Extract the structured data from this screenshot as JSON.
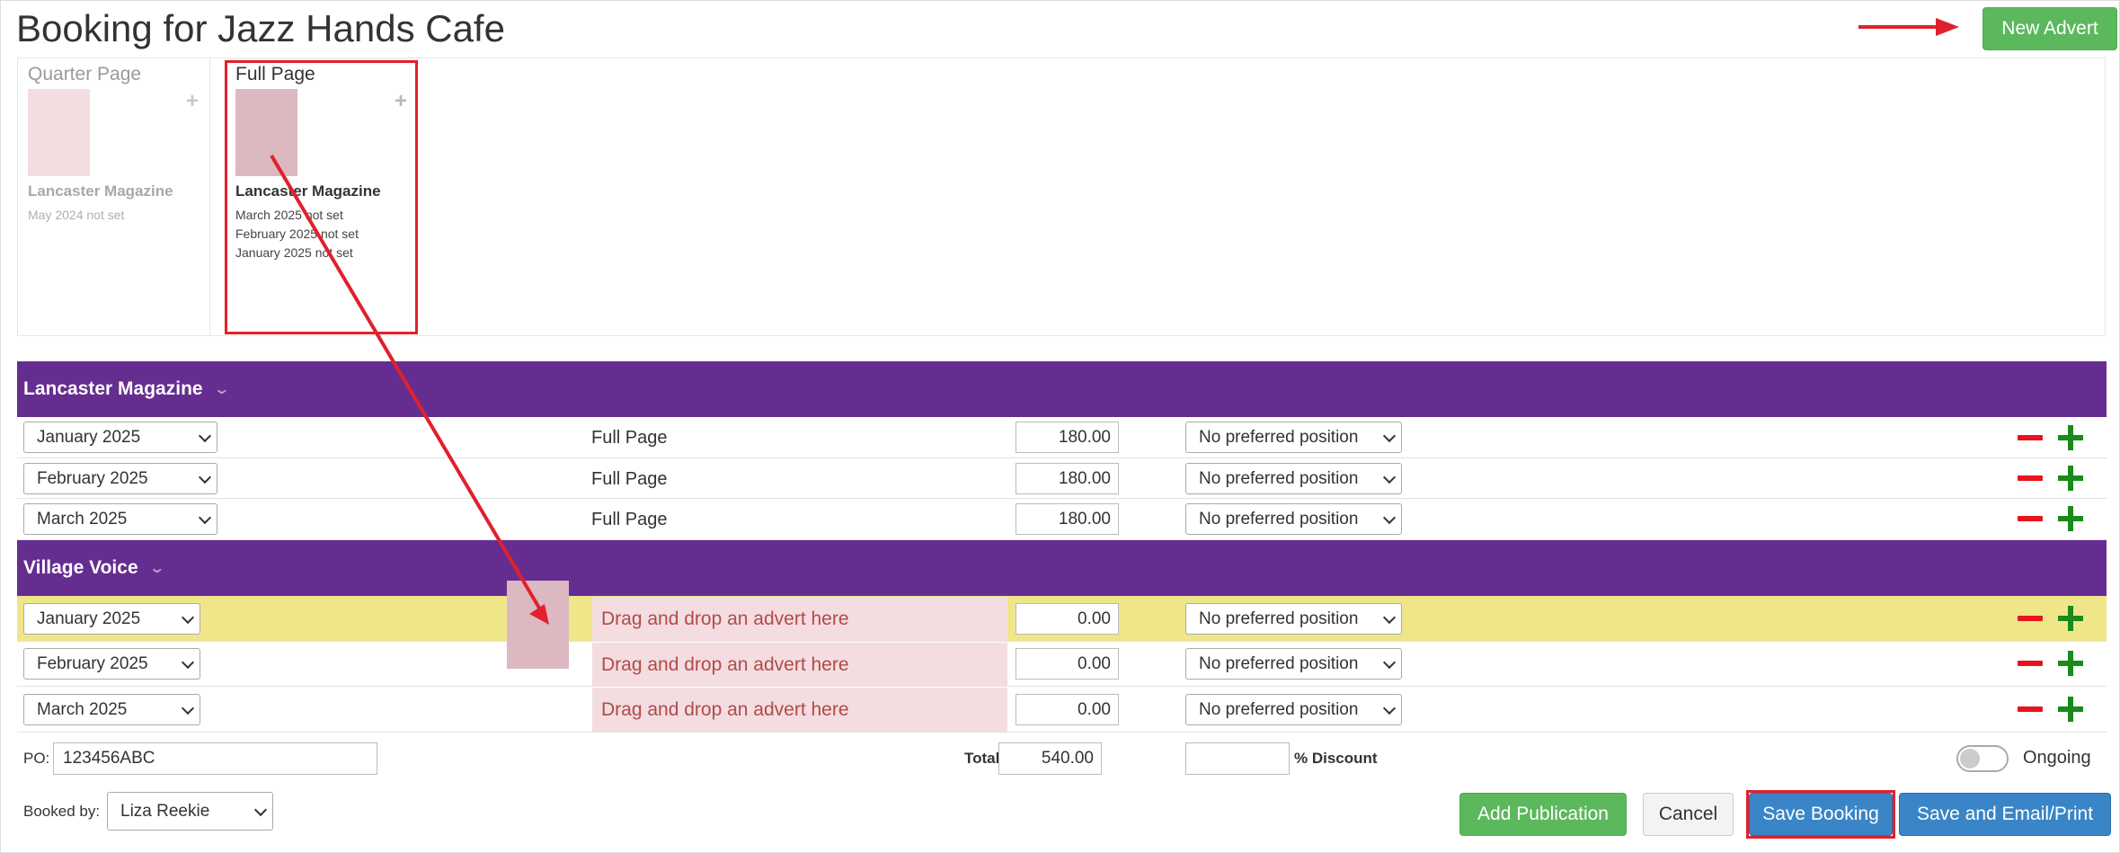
{
  "page": {
    "title": "Booking for Jazz Hands Cafe"
  },
  "header": {
    "new_advert_label": "New Advert"
  },
  "adverts": [
    {
      "size": "Quarter Page",
      "publication": "Lancaster Magazine",
      "dates": [
        "May 2024 not set"
      ]
    },
    {
      "size": "Full Page",
      "publication": "Lancaster Magazine",
      "dates": [
        "March 2025 not set",
        "February 2025 not set",
        "January 2025 not set"
      ]
    }
  ],
  "publications": [
    {
      "name": "Lancaster Magazine",
      "rows": [
        {
          "issue": "January 2025",
          "advert": "Full Page",
          "price": "180.00",
          "position": "No preferred position"
        },
        {
          "issue": "February 2025",
          "advert": "Full Page",
          "price": "180.00",
          "position": "No preferred position"
        },
        {
          "issue": "March 2025",
          "advert": "Full Page",
          "price": "180.00",
          "position": "No preferred position"
        }
      ]
    },
    {
      "name": "Village Voice",
      "rows": [
        {
          "issue": "January 2025",
          "advert": "Drag and drop an advert here",
          "price": "0.00",
          "position": "No preferred position"
        },
        {
          "issue": "February 2025",
          "advert": "Drag and drop an advert here",
          "price": "0.00",
          "position": "No preferred position"
        },
        {
          "issue": "March 2025",
          "advert": "Drag and drop an advert here",
          "price": "0.00",
          "position": "No preferred position"
        }
      ]
    }
  ],
  "footer": {
    "po_label": "PO:",
    "po_value": "123456ABC",
    "total_label": "Total",
    "total_value": "540.00",
    "discount_value": "",
    "discount_label": "% Discount",
    "ongoing_label": "Ongoing",
    "ongoing_on": false,
    "booked_by_label": "Booked by:",
    "booked_by_value": "Liza Reekie"
  },
  "actions": {
    "add_publication": "Add Publication",
    "cancel": "Cancel",
    "save_booking": "Save Booking",
    "save_email_print": "Save and Email/Print"
  },
  "colors": {
    "publication_header": "#662d91",
    "highlight_row": "#efe68a",
    "drop_zone": "#f3dde0",
    "annotation": "#e0212b",
    "success": "#5cb85c",
    "primary": "#3a85c7"
  }
}
